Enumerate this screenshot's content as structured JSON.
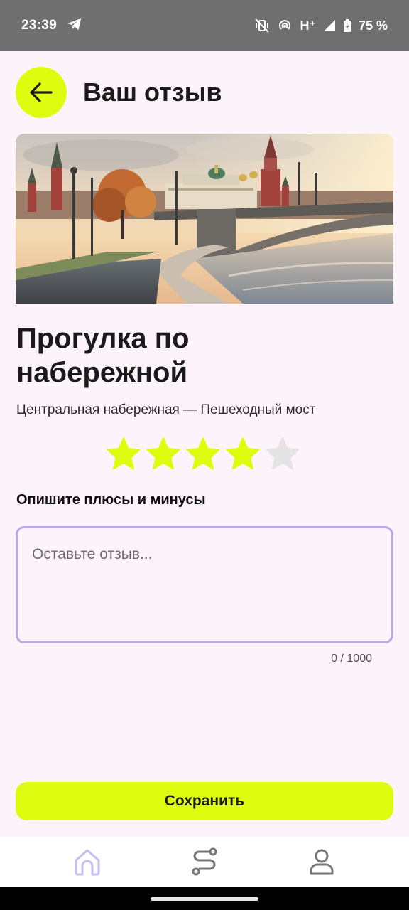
{
  "status_bar": {
    "time": "23:39",
    "network": "H⁺",
    "battery": "75 %"
  },
  "header": {
    "title": "Ваш отзыв",
    "back_icon": "arrow-left-icon"
  },
  "place": {
    "title": "Прогулка по набережной",
    "subtitle": "Центральная набережная — Пешеходный мост"
  },
  "rating": {
    "value": 4,
    "max": 5,
    "filled_color": "#ddfc10",
    "empty_color": "#e4e4e4"
  },
  "review": {
    "label": "Опишите плюсы и минусы",
    "placeholder": "Оставьте отзыв...",
    "value": "",
    "counter": "0 / 1000"
  },
  "actions": {
    "save_label": "Сохранить"
  },
  "bottom_nav": {
    "items": [
      {
        "icon": "home-icon",
        "active": true
      },
      {
        "icon": "route-icon",
        "active": false
      },
      {
        "icon": "profile-icon",
        "active": false
      }
    ]
  },
  "colors": {
    "accent": "#ddfc10",
    "background": "#fdf3fb",
    "input_border": "#b9a9e8",
    "active_nav": "#c7bdf0",
    "inactive_nav": "#777777"
  }
}
